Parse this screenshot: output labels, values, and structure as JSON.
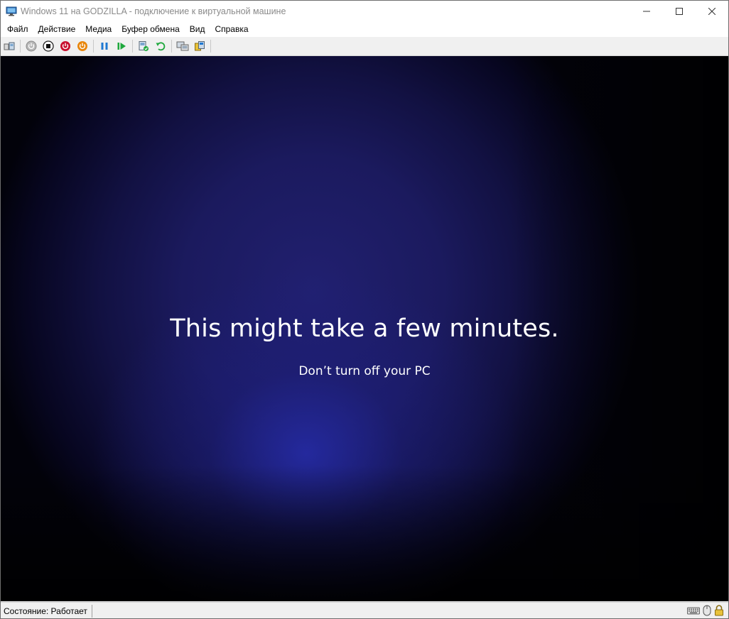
{
  "window": {
    "title": "Windows 11 на GODZILLA - подключение к виртуальной машине",
    "icon": "vm-connection-icon",
    "controls": [
      "minimize-icon",
      "maximize-icon",
      "close-icon"
    ]
  },
  "menu": {
    "items": [
      "Файл",
      "Действие",
      "Медиа",
      "Буфер обмена",
      "Вид",
      "Справка"
    ]
  },
  "toolbar": {
    "buttons": [
      {
        "icon": "ctrl-alt-del-icon"
      },
      {
        "icon": "start-icon"
      },
      {
        "icon": "turn-off-icon"
      },
      {
        "icon": "shut-down-icon"
      },
      {
        "icon": "save-state-icon"
      },
      {
        "icon": "pause-icon"
      },
      {
        "icon": "resume-icon"
      },
      {
        "icon": "checkpoint-icon"
      },
      {
        "icon": "revert-icon"
      },
      {
        "icon": "enhanced-session-icon"
      },
      {
        "icon": "share-icon"
      }
    ],
    "colors": {
      "red": "#c8102e",
      "orange": "#e8860c",
      "blue": "#1e78d2",
      "green": "#1ea83c"
    }
  },
  "vm_screen": {
    "headline": "This might take a few minutes.",
    "subline": "Don’t turn off your PC",
    "background_color": "#1b1a5e"
  },
  "statusbar": {
    "status": "Состояние: Работает",
    "tray_icons": [
      "keyboard-icon",
      "mouse-icon",
      "lock-icon"
    ]
  }
}
